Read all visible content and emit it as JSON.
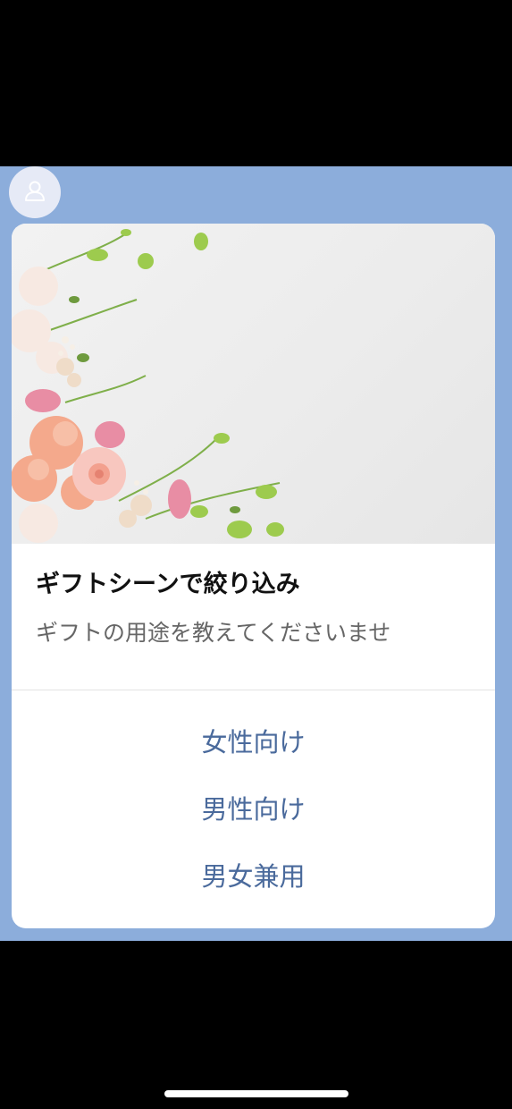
{
  "card": {
    "title": "ギフトシーンで絞り込み",
    "subtitle": "ギフトの用途を教えてくださいませ",
    "actions": [
      {
        "label": "女性向け"
      },
      {
        "label": "男性向け"
      },
      {
        "label": "男女兼用"
      }
    ]
  },
  "icons": {
    "avatar": "user-icon"
  },
  "colors": {
    "chat_background": "#8CADDB",
    "action_text": "#4A6A9C",
    "title_text": "#111111",
    "subtitle_text": "#666666"
  }
}
